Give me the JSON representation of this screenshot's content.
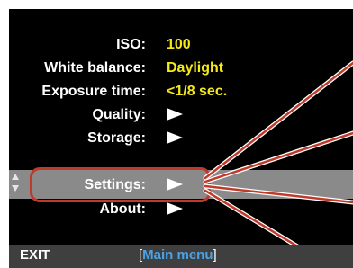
{
  "menu": {
    "items": [
      {
        "label": "ISO:",
        "value": "100"
      },
      {
        "label": "White balance:",
        "value": "Daylight"
      },
      {
        "label": "Exposure time:",
        "value": "<1/8 sec."
      },
      {
        "label": "Quality:",
        "value": ""
      },
      {
        "label": "Storage:",
        "value": ""
      },
      {
        "label": "Settings:",
        "value": ""
      },
      {
        "label": "About:",
        "value": ""
      }
    ],
    "selected_index": 5,
    "submenu_arrow_icon": "right-triangle-icon"
  },
  "footer": {
    "left": "EXIT",
    "bracket_open": "[",
    "title": "Main menu",
    "bracket_close": "]"
  },
  "colors": {
    "background": "#000000",
    "label": "#ffffff",
    "value": "#f5ea18",
    "highlight": "#8a8a8a",
    "callout": "#bf3a2b",
    "footer_bg": "#3f3f3f",
    "footer_title": "#4aa3e6"
  }
}
